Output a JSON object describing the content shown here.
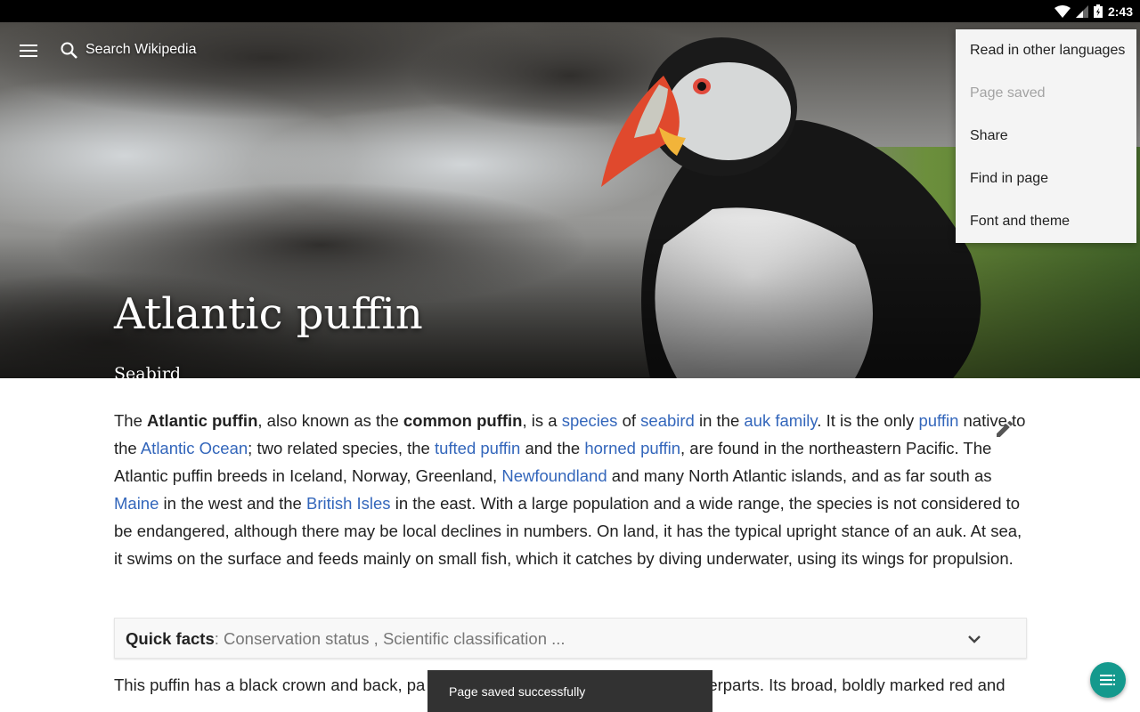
{
  "status_bar": {
    "time": "2:43"
  },
  "toolbar": {
    "search_placeholder": "Search Wikipedia"
  },
  "hero": {
    "title": "Atlantic puffin",
    "subtitle": "Seabird"
  },
  "overflow_menu": {
    "items": [
      {
        "label": "Read in other languages",
        "enabled": true
      },
      {
        "label": "Page saved",
        "enabled": false
      },
      {
        "label": "Share",
        "enabled": true
      },
      {
        "label": "Find in page",
        "enabled": true
      },
      {
        "label": "Font and theme",
        "enabled": true
      }
    ]
  },
  "article": {
    "p1": [
      {
        "t": "The "
      },
      {
        "t": "Atlantic puffin",
        "b": true
      },
      {
        "t": ", also known as the "
      },
      {
        "t": "common puffin",
        "b": true
      },
      {
        "t": ", is a "
      },
      {
        "t": "species",
        "link": true
      },
      {
        "t": " of "
      },
      {
        "t": "seabird",
        "link": true
      },
      {
        "t": " in the "
      },
      {
        "t": "auk family",
        "link": true
      },
      {
        "t": ". It is the only "
      },
      {
        "t": "puffin",
        "link": true
      },
      {
        "t": " native to the "
      },
      {
        "t": "Atlantic Ocean",
        "link": true
      },
      {
        "t": "; two related species, the "
      },
      {
        "t": "tufted puffin",
        "link": true
      },
      {
        "t": " and the "
      },
      {
        "t": "horned puffin",
        "link": true
      },
      {
        "t": ", are found in the northeastern Pacific. The Atlantic puffin breeds in Iceland, Norway, Greenland, "
      },
      {
        "t": "Newfoundland",
        "link": true
      },
      {
        "t": " and many North Atlantic islands, and as far south as "
      },
      {
        "t": "Maine",
        "link": true
      },
      {
        "t": " in the west and the "
      },
      {
        "t": "British Isles",
        "link": true
      },
      {
        "t": " in the east. With a large population and a wide range, the species is not considered to be endangered, although there may be local declines in numbers. On land, it has the typical upright stance of an auk. At sea, it swims on the surface and feeds mainly on small fish, which it catches by diving underwater, using its wings for propulsion."
      }
    ],
    "p2_visible": "This puffin has a black crown and back, pa",
    "p2_visible_right": "erparts. Its broad, boldly marked red and",
    "link_color": "#3366bb"
  },
  "quick_facts": {
    "label": "Quick facts",
    "summary": ": Conservation status , Scientific classification ..."
  },
  "snackbar": {
    "message": "Page saved successfully"
  },
  "fab": {
    "icon": "table-of-contents-icon",
    "color": "#14998d"
  }
}
